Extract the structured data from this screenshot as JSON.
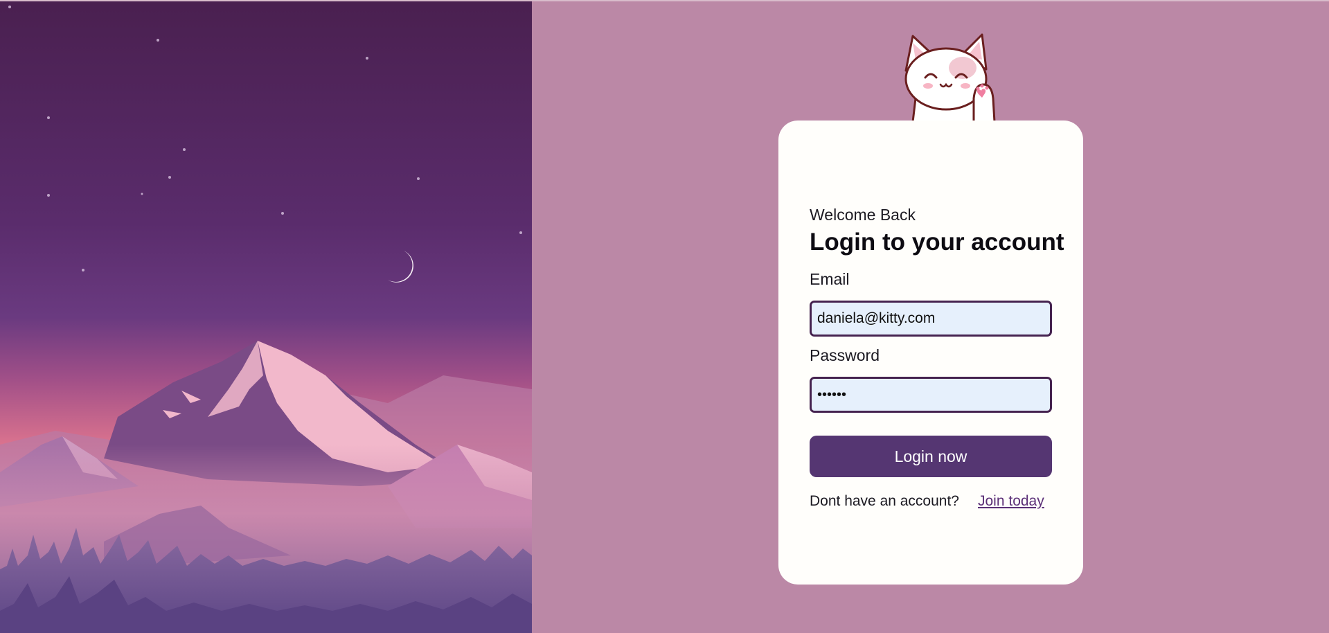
{
  "login": {
    "welcome": "Welcome Back",
    "title": "Login to your account",
    "email_label": "Email",
    "email_value": "daniela@kitty.com",
    "password_label": "Password",
    "password_value": "••••••",
    "button_label": "Login now",
    "footer_text": "Dont have an account?",
    "join_link": "Join today"
  },
  "colors": {
    "background": "#bb88a6",
    "card": "#fffefb",
    "primary": "#553672",
    "input_bg": "#e6f0fc",
    "input_border": "#45224f"
  },
  "icons": {
    "mascot": "cat-waving-icon",
    "scene": "mountain-night-illustration"
  }
}
